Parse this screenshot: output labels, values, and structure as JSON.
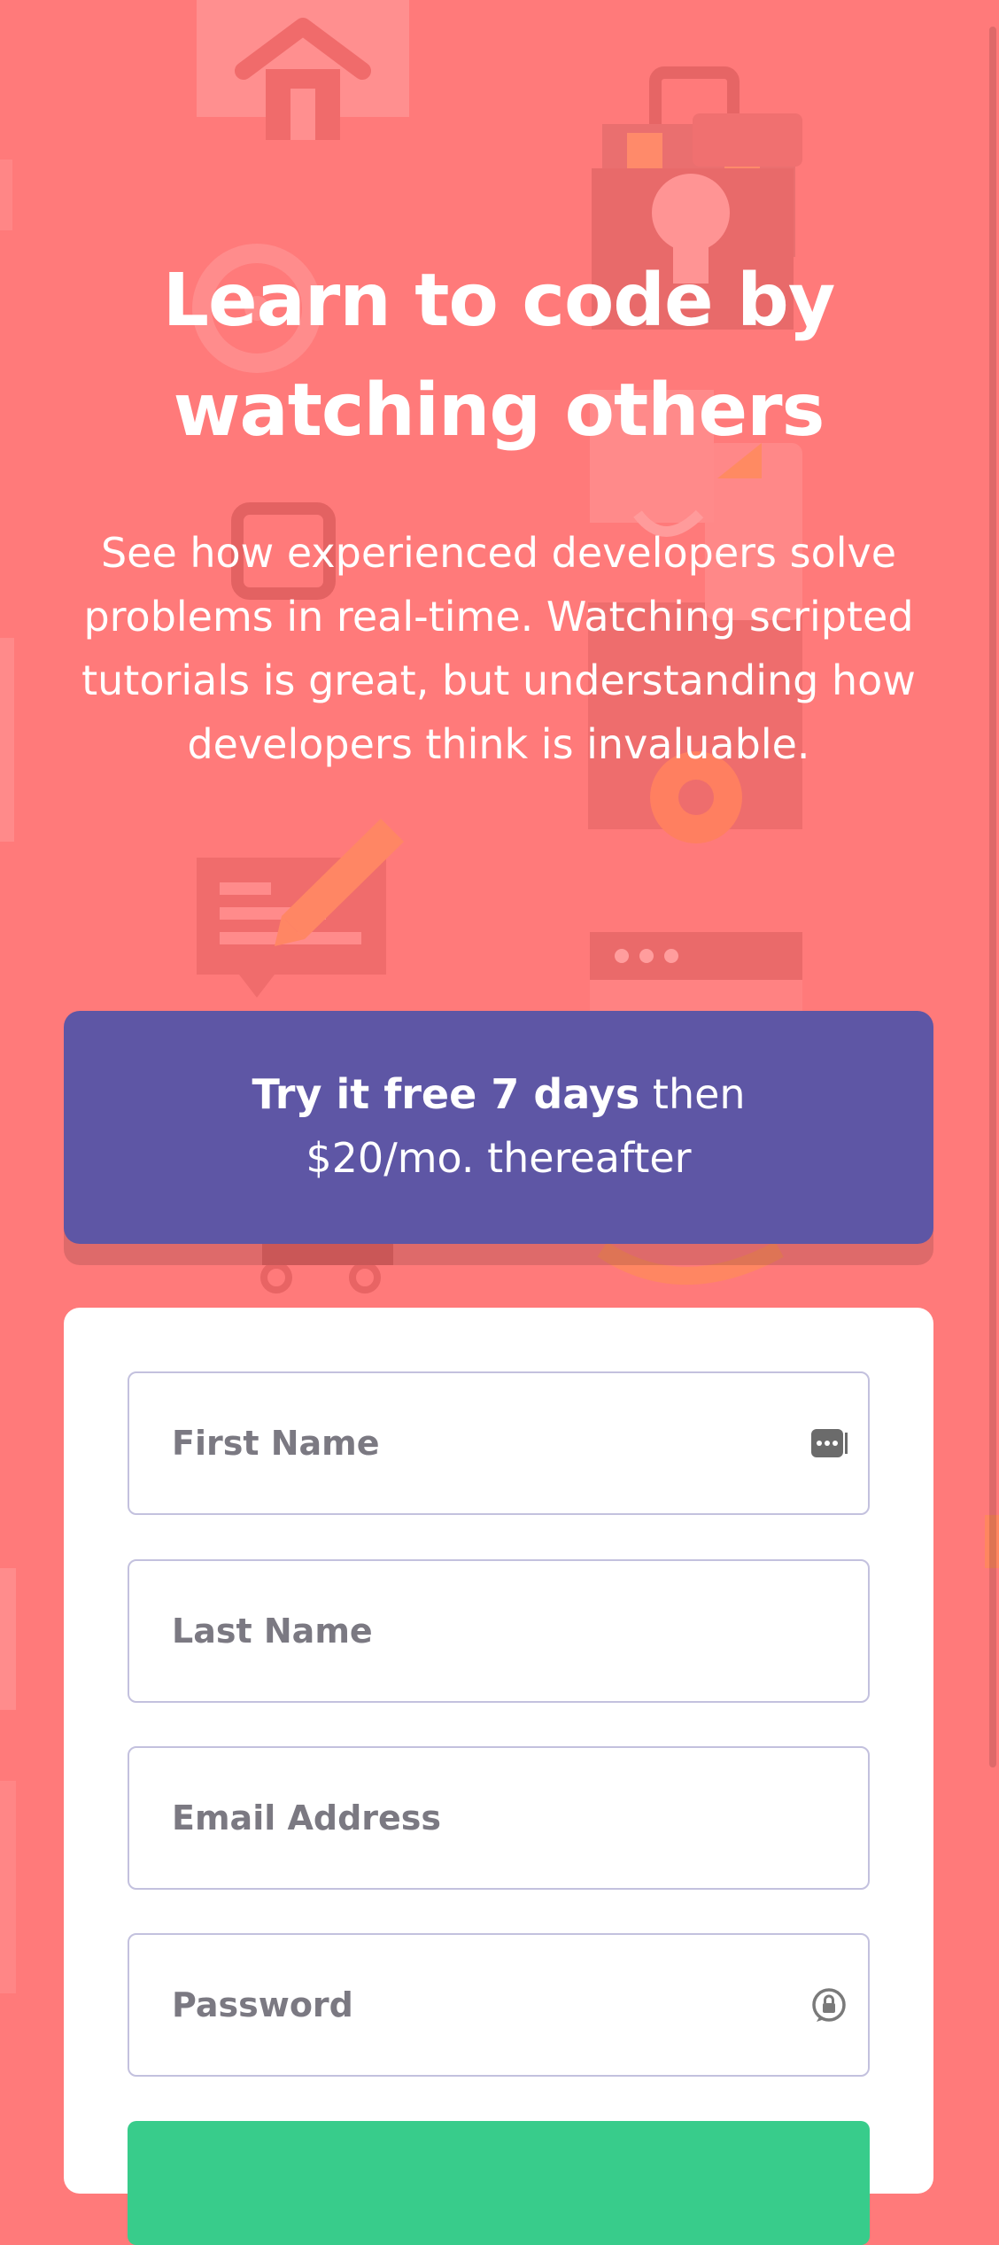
{
  "colors": {
    "background": "#ff7a7a",
    "promo": "#5e56a5",
    "card": "#ffffff",
    "field_border": "#c3c1de",
    "placeholder": "#7b7982",
    "submit": "#38cc8b"
  },
  "hero": {
    "headline": "Learn to code by watching others",
    "description": "See how experienced developers solve problems in real-time. Watching scripted tutorials is great, but understanding how developers think is invaluable."
  },
  "promo": {
    "highlight": "Try it free 7 days",
    "line_rest": " then",
    "line_two": "$20/mo. thereafter"
  },
  "form": {
    "first_name": {
      "placeholder": "First Name",
      "value": "",
      "icon": "autofill-dots-icon"
    },
    "last_name": {
      "placeholder": "Last Name",
      "value": ""
    },
    "email": {
      "placeholder": "Email Address",
      "value": ""
    },
    "password": {
      "placeholder": "Password",
      "value": "",
      "icon": "password-lock-icon"
    }
  },
  "background_icons": [
    "house-icon",
    "toolbox-icon",
    "cog-icon",
    "pencil-icon",
    "chat-icon",
    "browser-window-icon",
    "cart-icon",
    "atom-icon"
  ]
}
